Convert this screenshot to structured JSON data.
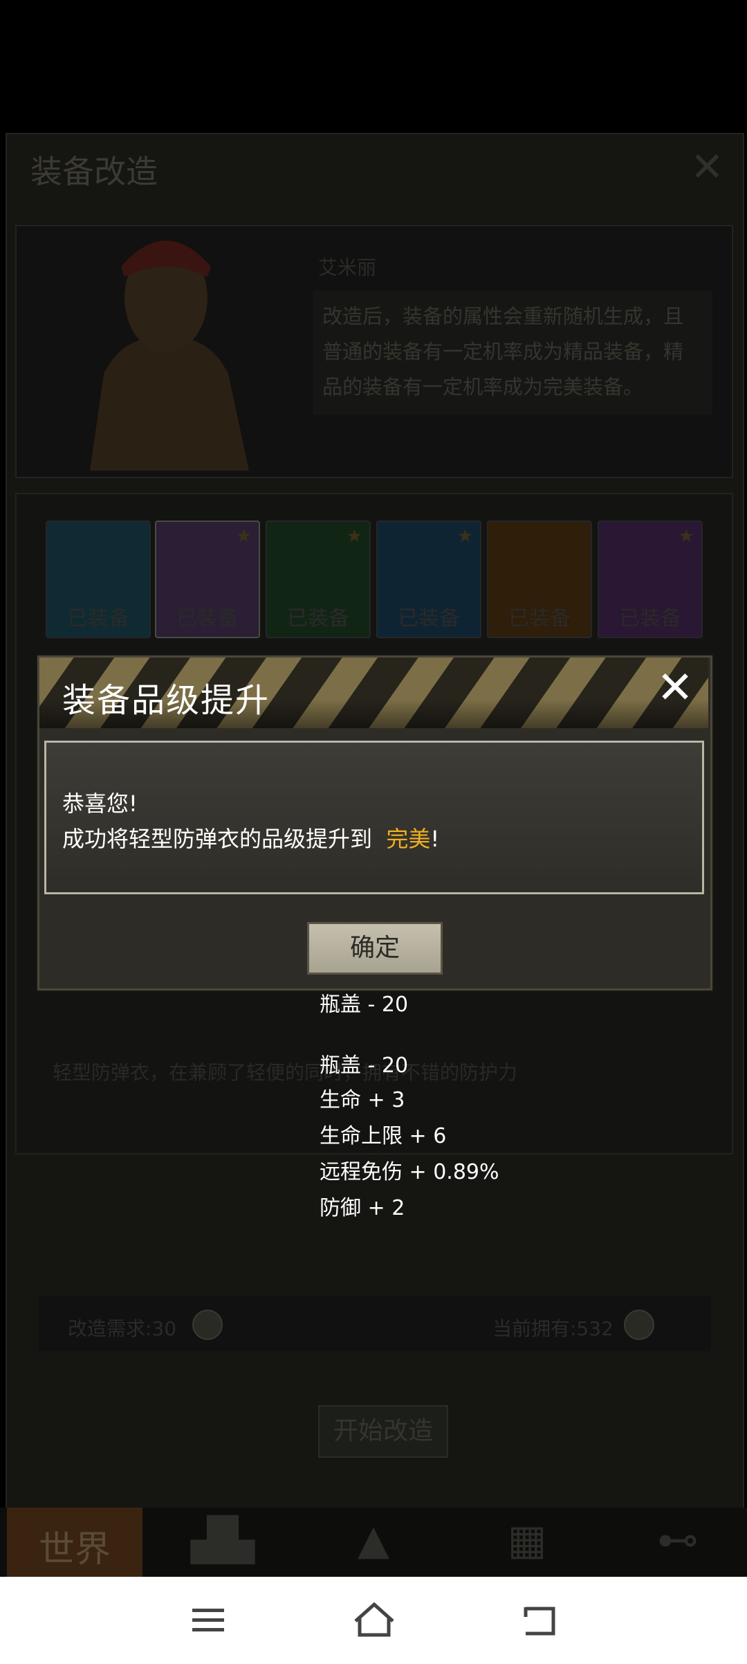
{
  "background": {
    "title": "装备改造",
    "npc_name": "艾米丽",
    "npc_description": "改造后，装备的属性会重新随机生成，且普通的装备有一定机率成为精品装备，精品的装备有一定机率成为完美装备。",
    "slots": [
      {
        "label": "已装备",
        "color": "#0f2a33",
        "starred": false
      },
      {
        "label": "已装备",
        "color": "#2a1f35",
        "starred": true
      },
      {
        "label": "已装备",
        "color": "#112515",
        "starred": true
      },
      {
        "label": "已装备",
        "color": "#0f2432",
        "starred": true
      },
      {
        "label": "已装备",
        "color": "#2e1e0a",
        "starred": false
      },
      {
        "label": "已装备",
        "color": "#2a1733",
        "starred": true
      }
    ],
    "item_description": "轻型防弹衣，在兼顾了轻便的同时，拥有不错的防护力",
    "requirement": "改造需求:30",
    "owned": "当前拥有:532",
    "start_button": "开始改造",
    "nav_world": "世界"
  },
  "dialog": {
    "title": "装备品级提升",
    "line1": "恭喜您!",
    "line2_prefix": "成功将轻型防弹衣的品级提升到",
    "line2_highlight": "完美",
    "line2_suffix": "!",
    "confirm": "确定",
    "highlight_color": "#f0b020"
  },
  "floating_stats": [
    "瓶盖 - 20",
    "瓶盖 - 20",
    "生命 + 3",
    "生命上限 + 6",
    "远程免伤 + 0.89%",
    "防御 + 2"
  ],
  "system_nav": {
    "icons": [
      "menu-icon",
      "home-icon",
      "back-icon"
    ]
  }
}
